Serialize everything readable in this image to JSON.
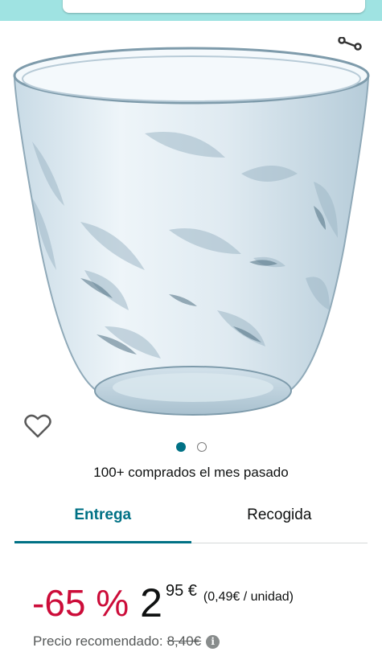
{
  "product": {
    "social_proof": "100+ comprados el mes pasado",
    "image_icon": "glass-tumbler-image"
  },
  "gallery": {
    "share_icon": "share-icon",
    "favorite_icon": "heart-icon",
    "total_images": 2,
    "active_image": 1
  },
  "tabs": [
    {
      "label": "Entrega",
      "active": true
    },
    {
      "label": "Recogida",
      "active": false
    }
  ],
  "price": {
    "discount": "-65 %",
    "whole": "2",
    "fraction": "95 €",
    "unit_price": "(0,49€ / unidad)",
    "list_price_label": "Precio recomendado:",
    "list_price_value": "8,40€"
  },
  "colors": {
    "header_bg": "#9fe3e2",
    "accent": "#007185",
    "discount": "#cc0c39",
    "muted": "#565959"
  }
}
